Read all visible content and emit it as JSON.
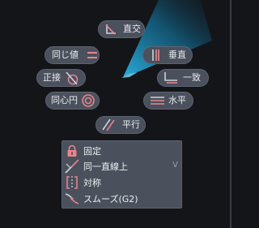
{
  "colors": {
    "accent": "#e8848c",
    "pill_bg": "#4a505c",
    "canvas_bg": "#141518",
    "beam": "#1aa8d8"
  },
  "constraints": {
    "perpendicular": {
      "label": "直交",
      "icon": "perpendicular-icon"
    },
    "equal": {
      "label": "同じ値",
      "icon": "equal-icon"
    },
    "vertical": {
      "label": "垂直",
      "icon": "vertical-icon"
    },
    "tangent": {
      "label": "正接",
      "icon": "tangent-icon"
    },
    "coincident": {
      "label": "一致",
      "icon": "coincident-icon"
    },
    "concentric": {
      "label": "同心円",
      "icon": "concentric-icon"
    },
    "horizontal": {
      "label": "水平",
      "icon": "horizontal-icon"
    },
    "parallel": {
      "label": "平行",
      "icon": "parallel-icon"
    }
  },
  "menu": {
    "items": [
      {
        "label": "固定",
        "icon": "lock-icon"
      },
      {
        "label": "同一直線上",
        "icon": "collinear-icon"
      },
      {
        "label": "対称",
        "icon": "symmetric-icon"
      },
      {
        "label": "スムーズ(G2)",
        "icon": "smooth-icon"
      }
    ],
    "chevron": "V"
  }
}
